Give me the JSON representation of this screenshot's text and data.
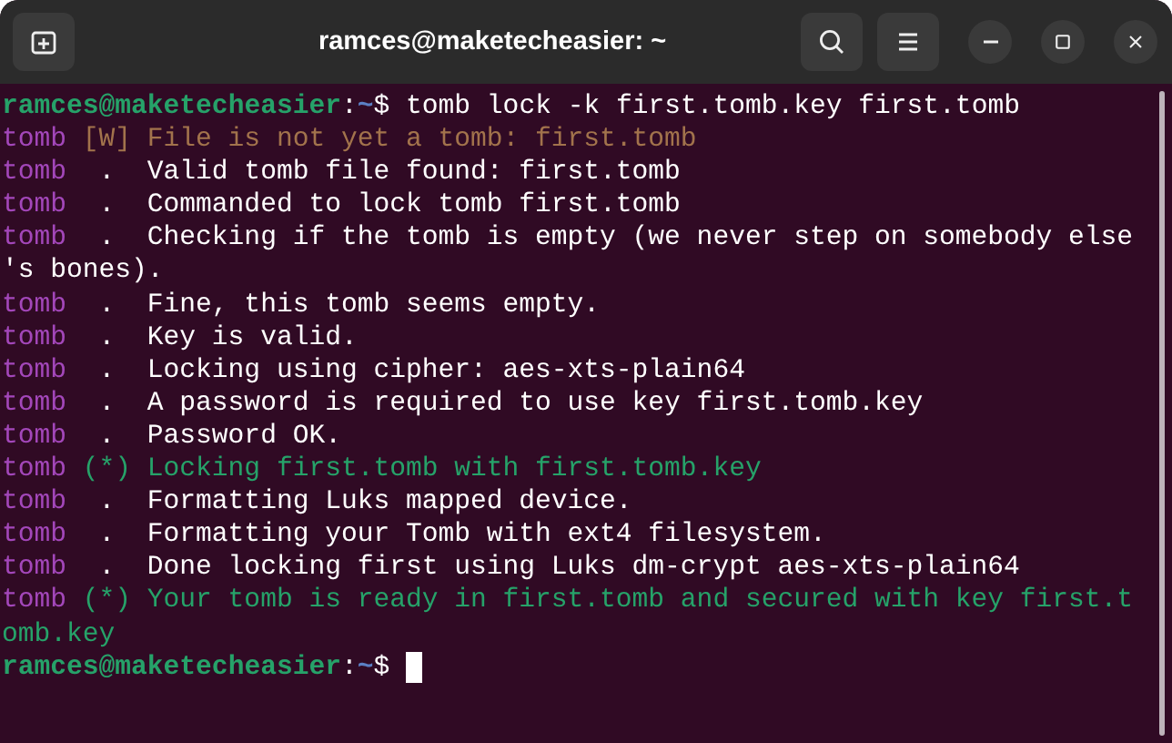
{
  "window": {
    "title": "ramces@maketecheasier: ~"
  },
  "terminal": {
    "lines": [
      {
        "kind": "prompt",
        "user": "ramces@maketecheasier",
        "separator": ":",
        "path": "~",
        "symbol": "$",
        "command": "tomb lock -k first.tomb.key first.tomb"
      },
      {
        "kind": "log",
        "color": "#a2734c",
        "source": "tomb",
        "marker": "[W]",
        "message": "File is not yet a tomb: first.tomb"
      },
      {
        "kind": "log",
        "color": "#ffffff",
        "source": "tomb",
        "marker": ".",
        "message": "Valid tomb file found: first.tomb"
      },
      {
        "kind": "log",
        "color": "#ffffff",
        "source": "tomb",
        "marker": ".",
        "message": "Commanded to lock tomb first.tomb"
      },
      {
        "kind": "log",
        "color": "#ffffff",
        "source": "tomb",
        "marker": ".",
        "message": "Checking if the tomb is empty (we never step on somebody else"
      },
      {
        "kind": "wrap",
        "color": "#ffffff",
        "text": "'s bones)."
      },
      {
        "kind": "log",
        "color": "#ffffff",
        "source": "tomb",
        "marker": ".",
        "message": "Fine, this tomb seems empty."
      },
      {
        "kind": "log",
        "color": "#ffffff",
        "source": "tomb",
        "marker": ".",
        "message": "Key is valid."
      },
      {
        "kind": "log",
        "color": "#ffffff",
        "source": "tomb",
        "marker": ".",
        "message": "Locking using cipher: aes-xts-plain64"
      },
      {
        "kind": "log",
        "color": "#ffffff",
        "source": "tomb",
        "marker": ".",
        "message": "A password is required to use key first.tomb.key"
      },
      {
        "kind": "log",
        "color": "#ffffff",
        "source": "tomb",
        "marker": ".",
        "message": "Password OK."
      },
      {
        "kind": "log",
        "color": "#26a269",
        "source": "tomb",
        "marker": "(*)",
        "message": "Locking first.tomb with first.tomb.key"
      },
      {
        "kind": "log",
        "color": "#ffffff",
        "source": "tomb",
        "marker": ".",
        "message": "Formatting Luks mapped device."
      },
      {
        "kind": "log",
        "color": "#ffffff",
        "source": "tomb",
        "marker": ".",
        "message": "Formatting your Tomb with ext4 filesystem."
      },
      {
        "kind": "log",
        "color": "#ffffff",
        "source": "tomb",
        "marker": ".",
        "message": "Done locking first using Luks dm-crypt aes-xts-plain64"
      },
      {
        "kind": "log",
        "color": "#26a269",
        "source": "tomb",
        "marker": "(*)",
        "message": "Your tomb is ready in first.tomb and secured with key first.t"
      },
      {
        "kind": "wrap",
        "color": "#26a269",
        "text": "omb.key"
      },
      {
        "kind": "prompt",
        "user": "ramces@maketecheasier",
        "separator": ":",
        "path": "~",
        "symbol": "$",
        "cursor": true
      }
    ]
  }
}
